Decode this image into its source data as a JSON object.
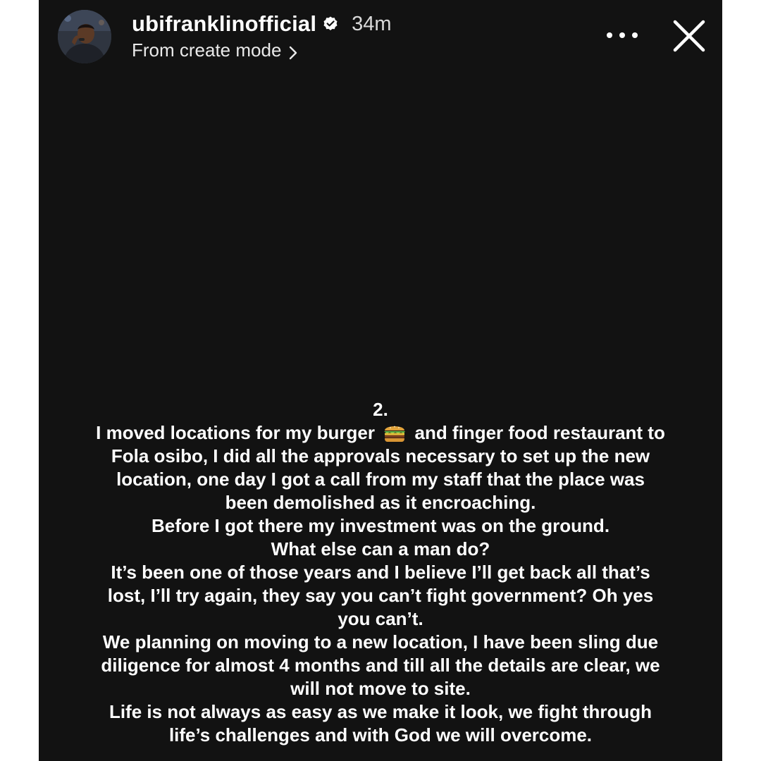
{
  "story": {
    "username": "ubifranklinofficial",
    "time_ago": "34m",
    "source_label": "From create mode",
    "icons": {
      "avatar": "profile-photo",
      "verified": "verified-badge-icon",
      "more": "more-options-icon",
      "close": "close-icon",
      "chevron": "chevron-right-icon",
      "emoji": "burger-emoji"
    }
  },
  "caption": {
    "line_01": "2.",
    "line_02_before": "I moved locations for my burger",
    "line_02_after": "and finger food restaurant to",
    "line_03": "Fola osibo, I did all the approvals necessary to set up the new",
    "line_04": "location, one day I got a call from my staff that the place was",
    "line_05": "been demolished as it encroaching.",
    "line_06": "Before I got there my investment was on the ground.",
    "line_07": "What else can a man do?",
    "line_08": "It’s been one of those years and I believe I’ll get back all that’s",
    "line_09": "lost, I’ll try again, they say you can’t fight government? Oh yes",
    "line_10": "you can’t.",
    "line_11": "We planning on moving to a new location, I have been sling due",
    "line_12": "diligence for almost 4 months and till all the details are clear, we",
    "line_13": "will not move to site.",
    "line_14": "Life is not always as easy as we make it look, we fight through",
    "line_15": "life’s challenges and with God we will overcome."
  },
  "colors": {
    "background": "#121212",
    "text": "#ffffff",
    "page_margin": "#ffffff"
  }
}
